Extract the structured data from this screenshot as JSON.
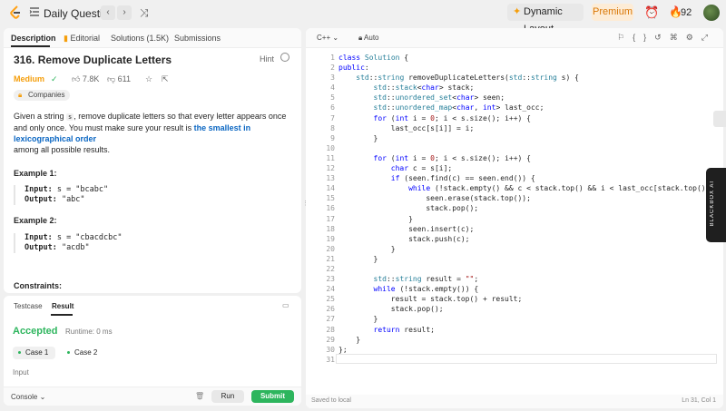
{
  "topbar": {
    "title": "Daily Question",
    "dynamic_layout": "Dynamic Layout",
    "premium": "Premium",
    "streak": "92"
  },
  "tabs": [
    "Description",
    "Editorial",
    "Solutions (1.5K)",
    "Submissions"
  ],
  "problem": {
    "title": "316. Remove Duplicate Letters",
    "hint": "Hint",
    "difficulty": "Medium",
    "likes": "7.8K",
    "dislikes": "611",
    "companies": "Companies",
    "desc_1": "Given a string ",
    "desc_code": "s",
    "desc_2": ", remove duplicate letters so that every letter appears once and only once. You must make sure your result is ",
    "desc_link": "the smallest in lexicographical order",
    "desc_3": "among all possible results.",
    "example1_title": "Example 1:",
    "example1_input_label": "Input:",
    "example1_input": " s = \"bcabc\"",
    "example1_output_label": "Output:",
    "example1_output": " \"abc\"",
    "example2_title": "Example 2:",
    "example2_input_label": "Input:",
    "example2_input": " s = \"cbacdcbc\"",
    "example2_output_label": "Output:",
    "example2_output": " \"acdb\"",
    "constraints": "Constraints:"
  },
  "bottom": {
    "tab_testcase": "Testcase",
    "tab_result": "Result",
    "status": "Accepted",
    "runtime": "Runtime: 0 ms",
    "case1": "Case 1",
    "case2": "Case 2",
    "input_label": "Input",
    "console": "Console",
    "run": "Run",
    "submit": "Submit"
  },
  "editor": {
    "language": "C++",
    "auto": "Auto",
    "saved": "Saved to local",
    "cursor": "Ln 31, Col 1",
    "line_numbers": [
      "1",
      "2",
      "3",
      "4",
      "5",
      "6",
      "7",
      "8",
      "9",
      "10",
      "11",
      "12",
      "13",
      "14",
      "15",
      "16",
      "17",
      "18",
      "19",
      "20",
      "21",
      "22",
      "23",
      "24",
      "25",
      "26",
      "27",
      "28",
      "29",
      "30",
      "31"
    ]
  },
  "blackbox_label": "BLACKBOX AI",
  "colors": {
    "accent_green": "#2db55d",
    "medium_orange": "#f59e0b",
    "link_blue": "#0a66c2"
  }
}
